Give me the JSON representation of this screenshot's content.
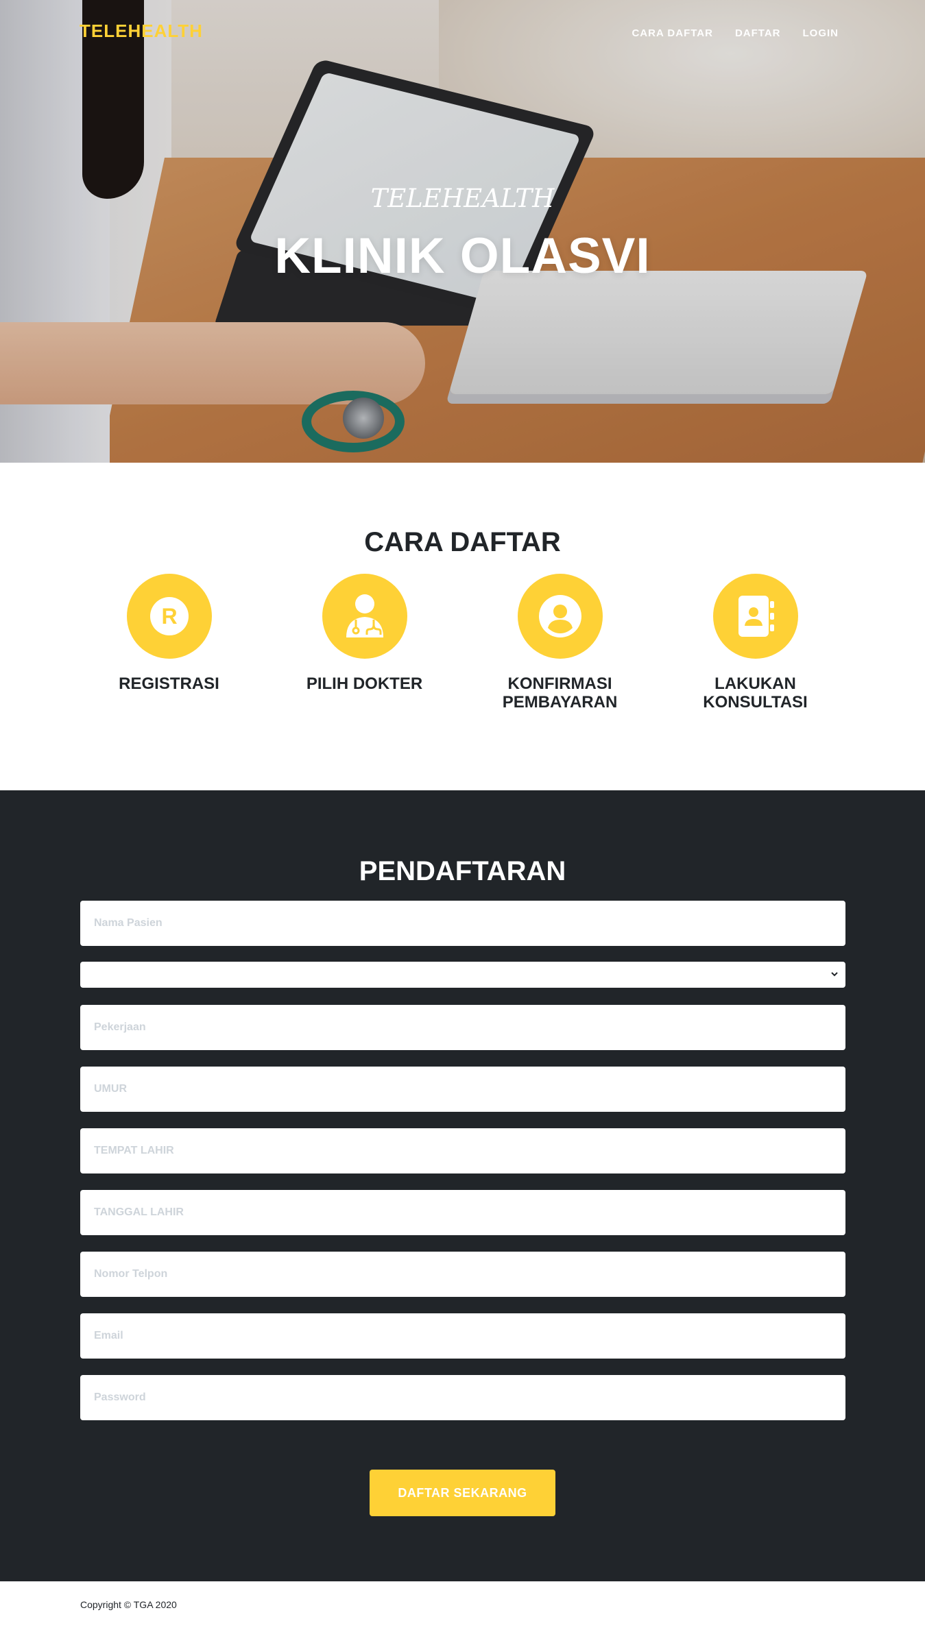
{
  "nav": {
    "brand": "TELEHEALTH",
    "items": [
      "CARA DAFTAR",
      "DAFTAR",
      "LOGIN"
    ]
  },
  "hero": {
    "subtitle": "TELEHEALTH",
    "title": "KLINIK OLASVI"
  },
  "steps": {
    "title": "CARA DAFTAR",
    "items": [
      {
        "label": "REGISTRASI",
        "icon": "registered-icon"
      },
      {
        "label": "PILIH DOKTER",
        "icon": "doctor-icon"
      },
      {
        "label": "KONFIRMASI PEMBAYARAN",
        "icon": "user-circle-icon"
      },
      {
        "label": "LAKUKAN KONSULTASI",
        "icon": "address-book-icon"
      }
    ]
  },
  "registration": {
    "title": "PENDAFTARAN",
    "fields": {
      "nama_pasien": "Nama Pasien",
      "gender_select": "",
      "pekerjaan": "Pekerjaan",
      "umur": "UMUR",
      "tempat_lahir": "TEMPAT LAHIR",
      "tanggal_lahir": "TANGGAL LAHIR",
      "nomor_telpon": "Nomor Telpon",
      "email": "Email",
      "password": "Password"
    },
    "submit_label": "DAFTAR SEKARANG"
  },
  "footer": {
    "copyright": "Copyright © TGA 2020"
  },
  "colors": {
    "accent": "#fed136",
    "dark": "#212529",
    "white": "#ffffff"
  }
}
